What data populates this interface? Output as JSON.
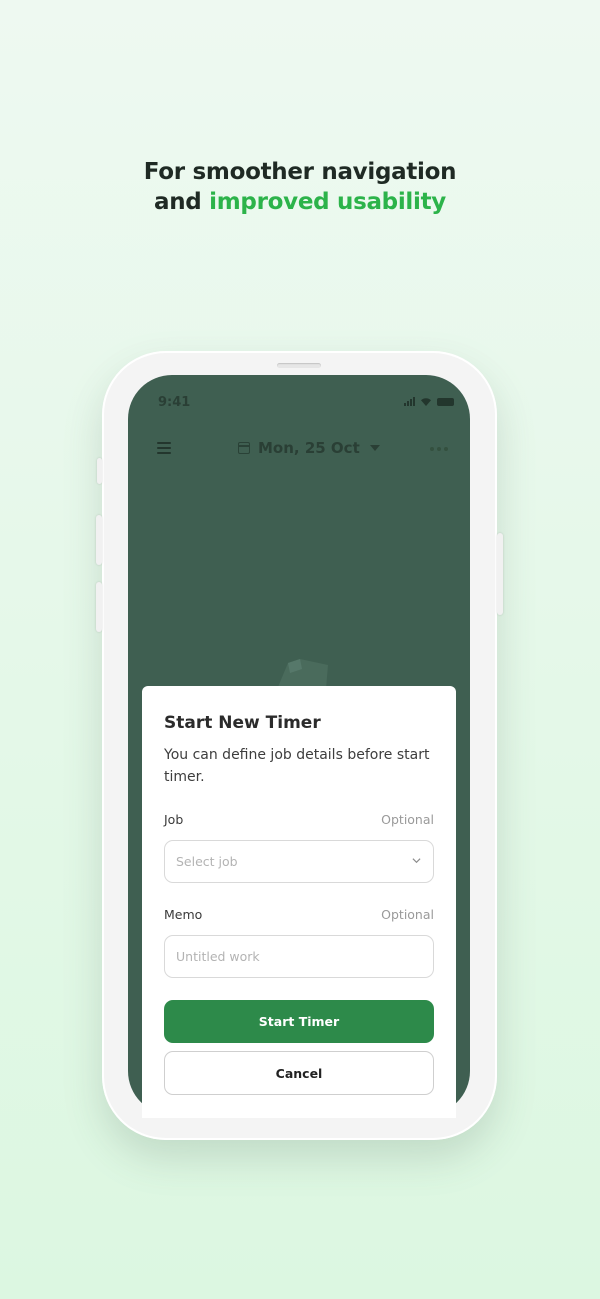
{
  "headline": {
    "line1": "For smoother navigation",
    "line2_prefix": "and ",
    "line2_accent": "improved usability",
    "accent_color": "#2cb34a"
  },
  "status_bar": {
    "time": "9:41",
    "icons": [
      "signal-icon",
      "wifi-icon",
      "battery-icon"
    ]
  },
  "app_header": {
    "date": "Mon, 25 Oct",
    "icons": [
      "menu-icon",
      "calendar-icon",
      "caret-down-icon",
      "more-icon"
    ]
  },
  "modal": {
    "title": "Start New Timer",
    "description": "You can define job details before start timer.",
    "job": {
      "label": "Job",
      "optional": "Optional",
      "placeholder": "Select job"
    },
    "memo": {
      "label": "Memo",
      "optional": "Optional",
      "placeholder": "Untitled work"
    },
    "start_label": "Start Timer",
    "cancel_label": "Cancel",
    "primary_color": "#2d8a4a"
  }
}
